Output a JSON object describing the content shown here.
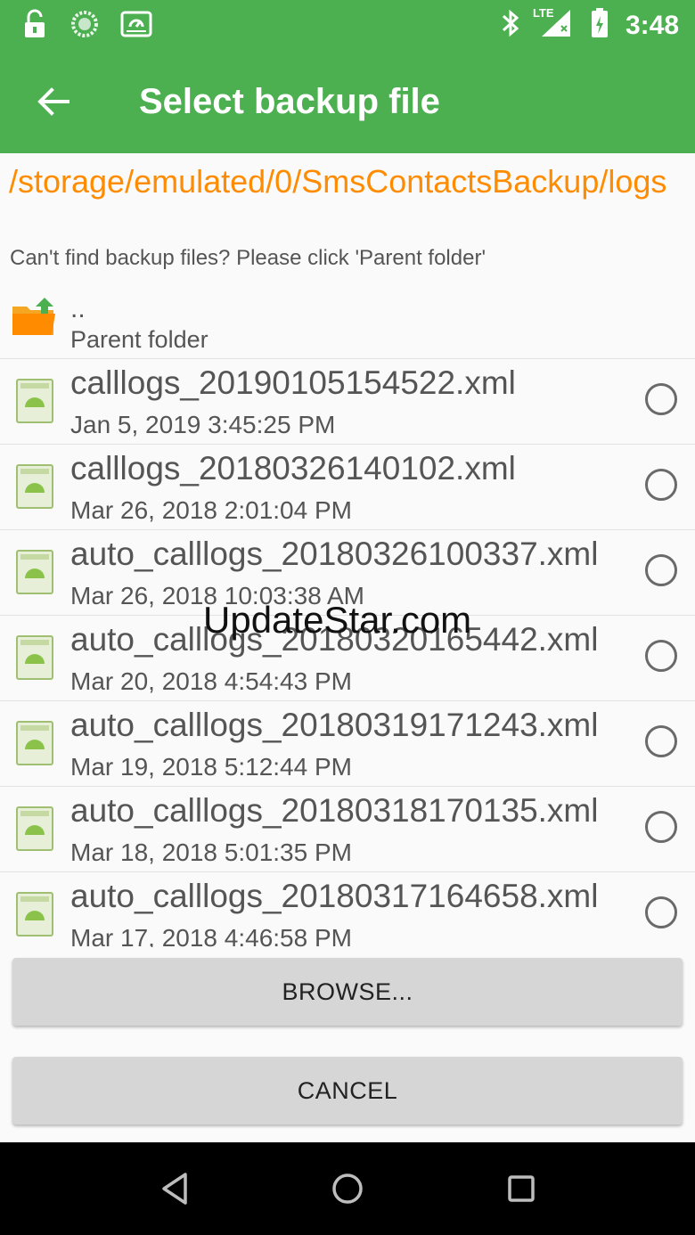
{
  "status_bar": {
    "time": "3:48",
    "network_label": "LTE",
    "left_icons": [
      "unlock-icon",
      "sync-circle-icon",
      "drive-icon"
    ],
    "right_icons": [
      "bluetooth-icon",
      "signal-icon",
      "battery-icon"
    ]
  },
  "app_bar": {
    "title": "Select backup file",
    "back_icon": "arrow-back-icon"
  },
  "path": "/storage/emulated/0/SmsContactsBackup/logs",
  "hint": "Can't find backup files? Please click 'Parent folder'",
  "parent_folder": {
    "dots": "..",
    "label": "Parent folder"
  },
  "files": [
    {
      "name": "calllogs_20190105154522.xml",
      "date": "Jan 5, 2019 3:45:25 PM"
    },
    {
      "name": "calllogs_20180326140102.xml",
      "date": "Mar 26, 2018 2:01:04 PM"
    },
    {
      "name": "auto_calllogs_20180326100337.xml",
      "date": "Mar 26, 2018 10:03:38 AM"
    },
    {
      "name": "auto_calllogs_20180320165442.xml",
      "date": "Mar 20, 2018 4:54:43 PM"
    },
    {
      "name": "auto_calllogs_20180319171243.xml",
      "date": "Mar 19, 2018 5:12:44 PM"
    },
    {
      "name": "auto_calllogs_20180318170135.xml",
      "date": "Mar 18, 2018 5:01:35 PM"
    },
    {
      "name": "auto_calllogs_20180317164658.xml",
      "date": "Mar 17, 2018 4:46:58 PM"
    }
  ],
  "buttons": {
    "browse": "BROWSE...",
    "cancel": "CANCEL"
  },
  "watermark": "UpdateStar.com",
  "colors": {
    "accent": "#4caf50",
    "path": "#ff8c00",
    "button": "#d6d6d6"
  }
}
